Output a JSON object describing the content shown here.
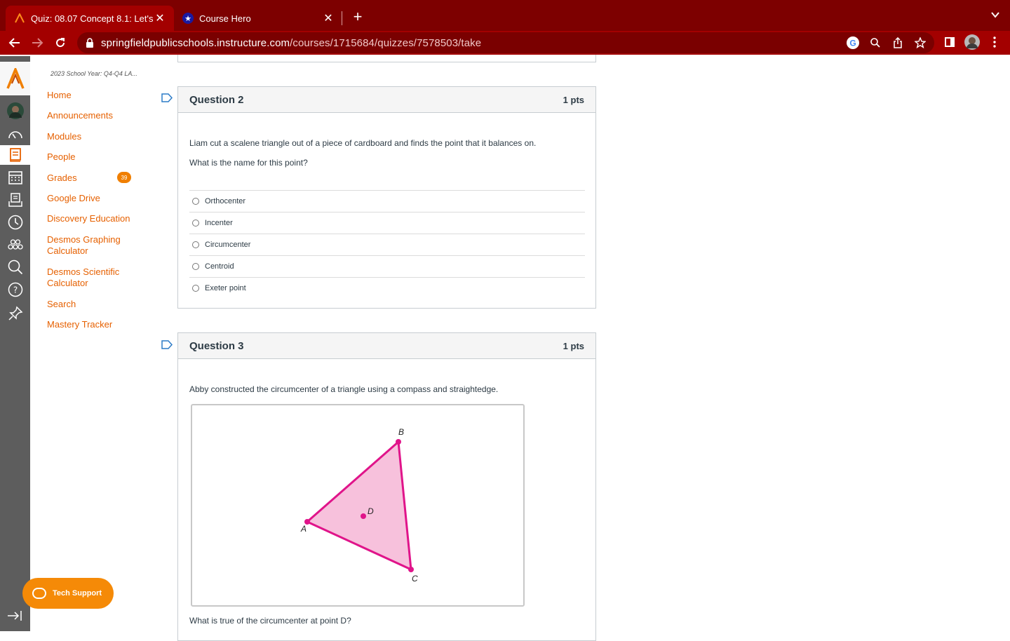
{
  "browser": {
    "tabs": [
      {
        "title": "Quiz: 08.07 Concept 8.1: Let's",
        "active": true,
        "favicon": "canvas-logo-icon"
      },
      {
        "title": "Course Hero",
        "active": false,
        "favicon": "star-icon"
      }
    ],
    "url_host": "springfieldpublicschools.instructure.com",
    "url_path": "/courses/1715684/quizzes/7578503/take",
    "accent": "#a30000"
  },
  "course_nav": {
    "breadcrumb": "2023 School Year: Q4-Q4 LA...",
    "items": [
      {
        "label": "Home"
      },
      {
        "label": "Announcements"
      },
      {
        "label": "Modules"
      },
      {
        "label": "People"
      },
      {
        "label": "Grades"
      },
      {
        "label": "Google Drive"
      },
      {
        "label": "Discovery Education"
      },
      {
        "label": "Desmos Graphing Calculator"
      },
      {
        "label": "Desmos Scientific Calculator"
      },
      {
        "label": "Search"
      },
      {
        "label": "Mastery Tracker"
      }
    ],
    "grades_badge": "39",
    "link_color": "#e66000"
  },
  "tech_support": {
    "label": "Tech Support"
  },
  "questions": [
    {
      "title": "Question 2",
      "points": "1 pts",
      "text_1": "Liam cut a scalene triangle out of a piece of cardboard and finds the point that it balances on.",
      "text_2": "What is the name for this point?",
      "answers": [
        "Orthocenter",
        "Incenter",
        "Circumcenter",
        "Centroid",
        "Exeter point"
      ]
    },
    {
      "title": "Question 3",
      "points": "1 pts",
      "text_1": "Abby constructed the circumcenter of a triangle using a compass and straightedge.",
      "figure_labels": {
        "a": "A",
        "b": "B",
        "c": "C",
        "d": "D"
      },
      "text_2": "What is true of the circumcenter at point D?"
    }
  ]
}
